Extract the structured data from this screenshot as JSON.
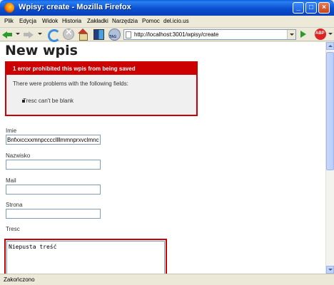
{
  "window": {
    "title": "Wpisy: create - Mozilla Firefox",
    "controls": [
      "_",
      "□",
      "×"
    ]
  },
  "menu": [
    "Plik",
    "Edycja",
    "Widok",
    "Historia",
    "Zakładki",
    "Narzędzia",
    "Pomoc",
    "del.icio.us"
  ],
  "toolbar": {
    "url": "http://localhost:3001/wpisy/create",
    "tag_label": "TAG",
    "abp_label": "ABP",
    "icons": [
      "back-icon",
      "forward-icon",
      "reload-icon",
      "stop-icon",
      "home-icon",
      "bookmark-icon",
      "tag-icon",
      "go-icon",
      "adblock-icon"
    ]
  },
  "page": {
    "title": "New wpis",
    "error": {
      "header": "1 error prohibited this wpis from being saved",
      "intro": "There were problems with the following fields:",
      "items": [
        "Tresc can't be blank"
      ]
    },
    "fields": {
      "imie": {
        "label": "Imie",
        "value": "Bnfxxccxxmnpccccllllmmnprxvclmnc"
      },
      "nazwisko": {
        "label": "Nazwisko",
        "value": ""
      },
      "mail": {
        "label": "Mail",
        "value": ""
      },
      "strona": {
        "label": "Strona",
        "value": ""
      },
      "tresc": {
        "label": "Tresc",
        "value": "Niepusta treść"
      }
    }
  },
  "status": "Zakończono"
}
